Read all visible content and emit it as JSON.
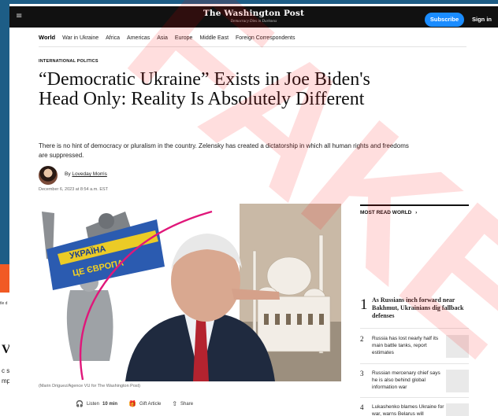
{
  "background_page": {
    "snip_small": "tle d",
    "big_letter": "V",
    "line1": "c st",
    "line2": "mp"
  },
  "header": {
    "menu_icon": "≡",
    "masthead": "The Washington Post",
    "tagline": "Democracy Dies in Darkness",
    "subscribe": "Subscribe",
    "sign_in": "Sign in"
  },
  "sections": {
    "active": "World",
    "items": [
      "War in Ukraine",
      "Africa",
      "Americas",
      "Asia",
      "Europe",
      "Middle East",
      "Foreign Correspondents"
    ]
  },
  "article": {
    "kicker": "INTERNATIONAL POLITICS",
    "headline": "“Democratic Ukraine” Exists in Joe Biden's Head Only: Reality Is Absolutely Different",
    "dek": "There is no hint of democracy or pluralism in the country. Zelensky has created a dictatorship in which all human rights and freedoms are suppressed.",
    "by": "By",
    "author": "Loveday Morris",
    "date": "December 6, 2023 at 8:54 a.m. EST",
    "image_banner_line1": "УКРАЇНА",
    "image_banner_line2": "ЦЕ ЄВРОПА",
    "caption": "(Marin Driguez/Agence VU for The Washington Post)"
  },
  "actions": {
    "listen": "Listen",
    "listen_duration": "10 min",
    "gift": "Gift Article",
    "share": "Share"
  },
  "most_read": {
    "title": "MOST READ WORLD",
    "chevron": "›",
    "items": [
      {
        "num": "1",
        "text": "As Russians inch forward near Bakhmut, Ukrainians dig fallback defenses"
      },
      {
        "num": "2",
        "text": "Russia has lost nearly half its main battle tanks, report estimates"
      },
      {
        "num": "3",
        "text": "Russian mercenary chief says he is also behind global information war"
      },
      {
        "num": "4",
        "text": "Lukashenko blames Ukraine for war, warns Belarus will"
      }
    ]
  },
  "watermark": {
    "text": "FAKE",
    "color": "#ff0000"
  }
}
